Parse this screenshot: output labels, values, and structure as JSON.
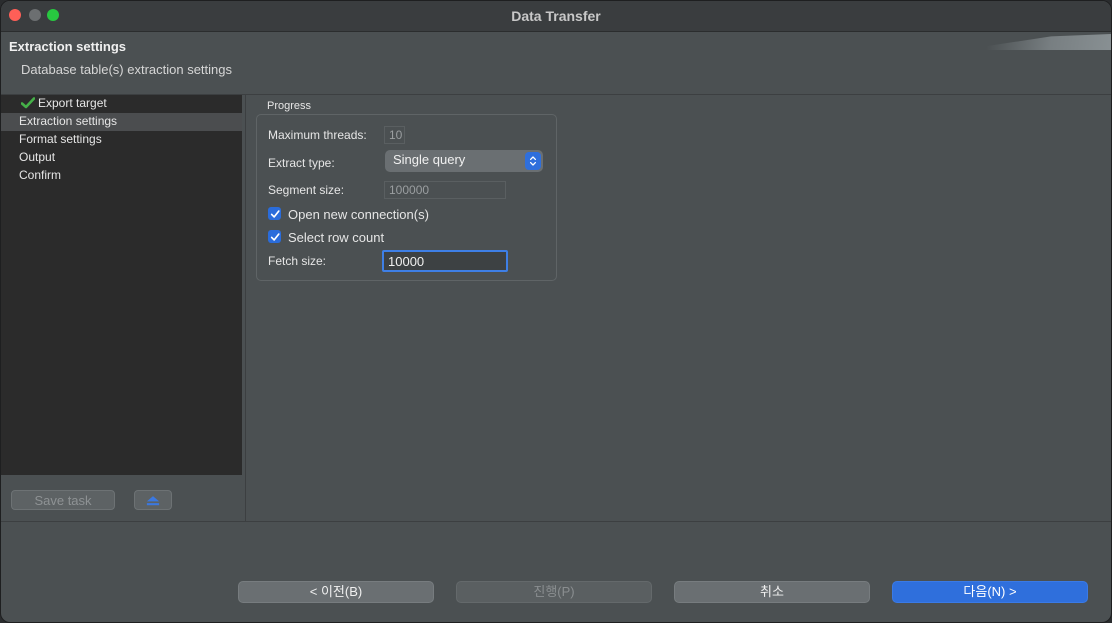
{
  "window": {
    "title": "Data Transfer"
  },
  "header": {
    "title": "Extraction settings",
    "description": "Database table(s) extraction settings"
  },
  "sidebar": {
    "items": [
      {
        "label": "Export target",
        "completed": true
      },
      {
        "label": "Extraction settings",
        "selected": true
      },
      {
        "label": "Format settings"
      },
      {
        "label": "Output"
      },
      {
        "label": "Confirm"
      }
    ],
    "save_task_label": "Save task"
  },
  "progress": {
    "group_label": "Progress",
    "max_threads_label": "Maximum threads:",
    "max_threads_value": "10",
    "extract_type_label": "Extract type:",
    "extract_type_value": "Single query",
    "segment_size_label": "Segment size:",
    "segment_size_value": "100000",
    "open_new_connections_label": "Open new connection(s)",
    "open_new_connections_checked": true,
    "select_row_count_label": "Select row count",
    "select_row_count_checked": true,
    "fetch_size_label": "Fetch size:",
    "fetch_size_value": "10000"
  },
  "footer": {
    "back_label": "< 이전(B)",
    "proceed_label": "진행(P)",
    "cancel_label": "취소",
    "next_label": "다음(N) >"
  },
  "colors": {
    "accent": "#2f6fdc",
    "check_green": "#45b048",
    "window_bg": "#4b5052",
    "sidebar_bg": "#2b2b2b"
  }
}
